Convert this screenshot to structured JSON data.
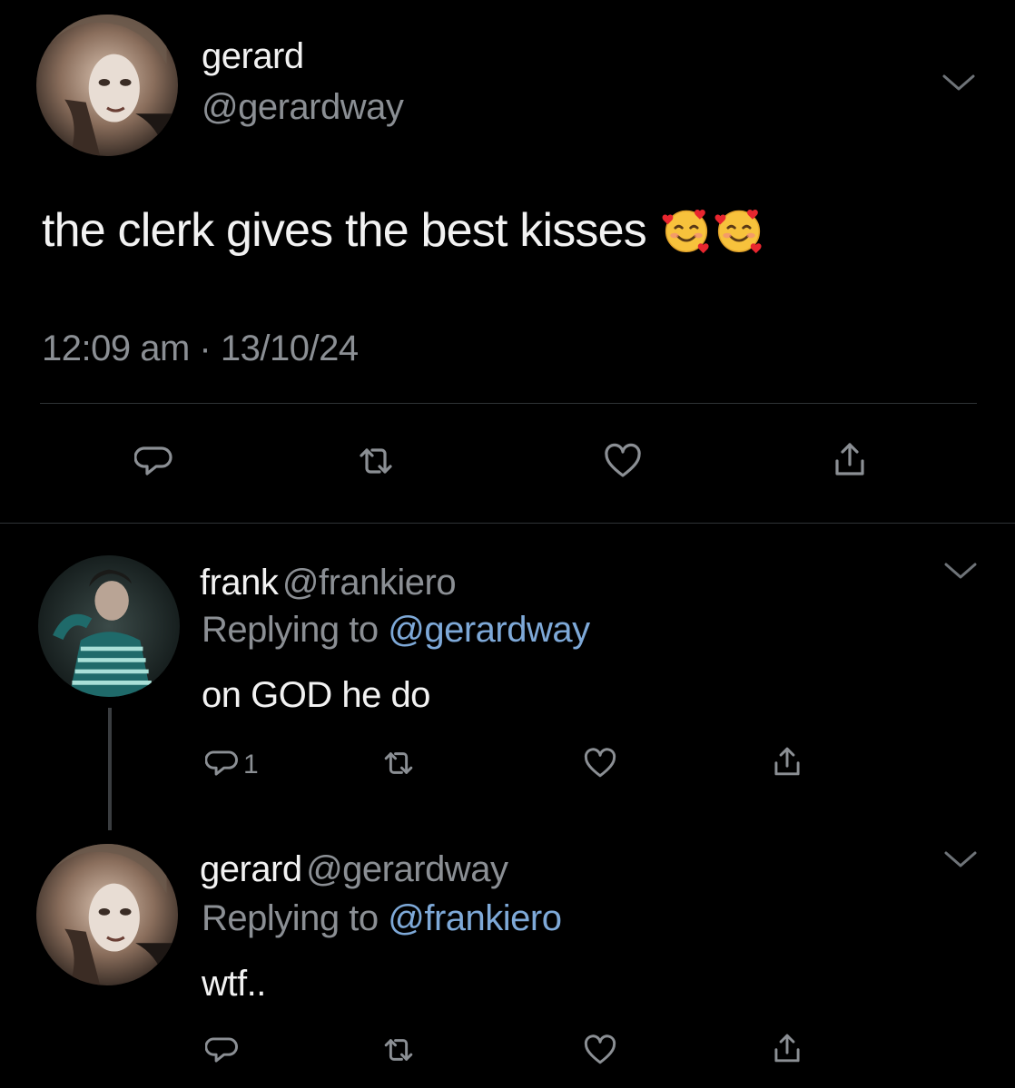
{
  "main_tweet": {
    "display_name": "gerard",
    "handle": "@gerardway",
    "text": "the clerk gives the best kisses",
    "emojis": [
      "smiling-face-with-hearts",
      "smiling-face-with-hearts"
    ],
    "time": "12:09 am",
    "separator": "·",
    "date": "13/10/24",
    "actions": [
      "reply-icon",
      "retweet-icon",
      "like-icon",
      "share-icon"
    ]
  },
  "replies": [
    {
      "display_name": "frank",
      "handle": "@frankiero",
      "replying_prefix": "Replying to",
      "replying_to": "@gerardway",
      "text": "on GOD he do",
      "reply_count": "1"
    },
    {
      "display_name": "gerard",
      "handle": "@gerardway",
      "replying_prefix": "Replying to",
      "replying_to": "@frankiero",
      "text": "wtf..",
      "reply_count": ""
    }
  ],
  "colors": {
    "background": "#000000",
    "primary_text": "#f2f2f2",
    "secondary_text": "#8b8f94",
    "mention": "#7ea9d8",
    "divider": "#2f3336"
  }
}
